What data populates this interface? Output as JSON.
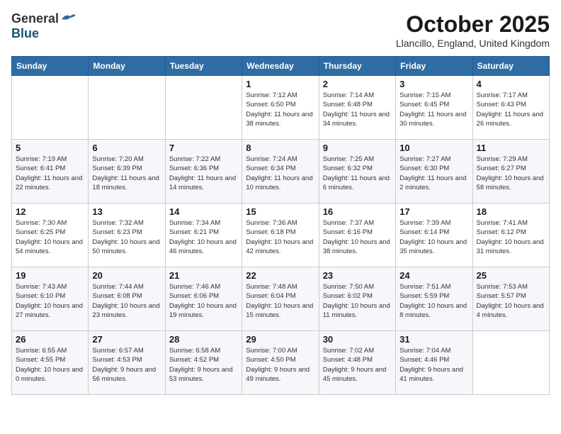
{
  "logo": {
    "general": "General",
    "blue": "Blue"
  },
  "title": "October 2025",
  "location": "Llancillo, England, United Kingdom",
  "days_of_week": [
    "Sunday",
    "Monday",
    "Tuesday",
    "Wednesday",
    "Thursday",
    "Friday",
    "Saturday"
  ],
  "weeks": [
    [
      {
        "day": "",
        "sunrise": "",
        "sunset": "",
        "daylight": ""
      },
      {
        "day": "",
        "sunrise": "",
        "sunset": "",
        "daylight": ""
      },
      {
        "day": "",
        "sunrise": "",
        "sunset": "",
        "daylight": ""
      },
      {
        "day": "1",
        "sunrise": "Sunrise: 7:12 AM",
        "sunset": "Sunset: 6:50 PM",
        "daylight": "Daylight: 11 hours and 38 minutes."
      },
      {
        "day": "2",
        "sunrise": "Sunrise: 7:14 AM",
        "sunset": "Sunset: 6:48 PM",
        "daylight": "Daylight: 11 hours and 34 minutes."
      },
      {
        "day": "3",
        "sunrise": "Sunrise: 7:15 AM",
        "sunset": "Sunset: 6:45 PM",
        "daylight": "Daylight: 11 hours and 30 minutes."
      },
      {
        "day": "4",
        "sunrise": "Sunrise: 7:17 AM",
        "sunset": "Sunset: 6:43 PM",
        "daylight": "Daylight: 11 hours and 26 minutes."
      }
    ],
    [
      {
        "day": "5",
        "sunrise": "Sunrise: 7:19 AM",
        "sunset": "Sunset: 6:41 PM",
        "daylight": "Daylight: 11 hours and 22 minutes."
      },
      {
        "day": "6",
        "sunrise": "Sunrise: 7:20 AM",
        "sunset": "Sunset: 6:39 PM",
        "daylight": "Daylight: 11 hours and 18 minutes."
      },
      {
        "day": "7",
        "sunrise": "Sunrise: 7:22 AM",
        "sunset": "Sunset: 6:36 PM",
        "daylight": "Daylight: 11 hours and 14 minutes."
      },
      {
        "day": "8",
        "sunrise": "Sunrise: 7:24 AM",
        "sunset": "Sunset: 6:34 PM",
        "daylight": "Daylight: 11 hours and 10 minutes."
      },
      {
        "day": "9",
        "sunrise": "Sunrise: 7:25 AM",
        "sunset": "Sunset: 6:32 PM",
        "daylight": "Daylight: 11 hours and 6 minutes."
      },
      {
        "day": "10",
        "sunrise": "Sunrise: 7:27 AM",
        "sunset": "Sunset: 6:30 PM",
        "daylight": "Daylight: 11 hours and 2 minutes."
      },
      {
        "day": "11",
        "sunrise": "Sunrise: 7:29 AM",
        "sunset": "Sunset: 6:27 PM",
        "daylight": "Daylight: 10 hours and 58 minutes."
      }
    ],
    [
      {
        "day": "12",
        "sunrise": "Sunrise: 7:30 AM",
        "sunset": "Sunset: 6:25 PM",
        "daylight": "Daylight: 10 hours and 54 minutes."
      },
      {
        "day": "13",
        "sunrise": "Sunrise: 7:32 AM",
        "sunset": "Sunset: 6:23 PM",
        "daylight": "Daylight: 10 hours and 50 minutes."
      },
      {
        "day": "14",
        "sunrise": "Sunrise: 7:34 AM",
        "sunset": "Sunset: 6:21 PM",
        "daylight": "Daylight: 10 hours and 46 minutes."
      },
      {
        "day": "15",
        "sunrise": "Sunrise: 7:36 AM",
        "sunset": "Sunset: 6:18 PM",
        "daylight": "Daylight: 10 hours and 42 minutes."
      },
      {
        "day": "16",
        "sunrise": "Sunrise: 7:37 AM",
        "sunset": "Sunset: 6:16 PM",
        "daylight": "Daylight: 10 hours and 38 minutes."
      },
      {
        "day": "17",
        "sunrise": "Sunrise: 7:39 AM",
        "sunset": "Sunset: 6:14 PM",
        "daylight": "Daylight: 10 hours and 35 minutes."
      },
      {
        "day": "18",
        "sunrise": "Sunrise: 7:41 AM",
        "sunset": "Sunset: 6:12 PM",
        "daylight": "Daylight: 10 hours and 31 minutes."
      }
    ],
    [
      {
        "day": "19",
        "sunrise": "Sunrise: 7:43 AM",
        "sunset": "Sunset: 6:10 PM",
        "daylight": "Daylight: 10 hours and 27 minutes."
      },
      {
        "day": "20",
        "sunrise": "Sunrise: 7:44 AM",
        "sunset": "Sunset: 6:08 PM",
        "daylight": "Daylight: 10 hours and 23 minutes."
      },
      {
        "day": "21",
        "sunrise": "Sunrise: 7:46 AM",
        "sunset": "Sunset: 6:06 PM",
        "daylight": "Daylight: 10 hours and 19 minutes."
      },
      {
        "day": "22",
        "sunrise": "Sunrise: 7:48 AM",
        "sunset": "Sunset: 6:04 PM",
        "daylight": "Daylight: 10 hours and 15 minutes."
      },
      {
        "day": "23",
        "sunrise": "Sunrise: 7:50 AM",
        "sunset": "Sunset: 6:02 PM",
        "daylight": "Daylight: 10 hours and 11 minutes."
      },
      {
        "day": "24",
        "sunrise": "Sunrise: 7:51 AM",
        "sunset": "Sunset: 5:59 PM",
        "daylight": "Daylight: 10 hours and 8 minutes."
      },
      {
        "day": "25",
        "sunrise": "Sunrise: 7:53 AM",
        "sunset": "Sunset: 5:57 PM",
        "daylight": "Daylight: 10 hours and 4 minutes."
      }
    ],
    [
      {
        "day": "26",
        "sunrise": "Sunrise: 6:55 AM",
        "sunset": "Sunset: 4:55 PM",
        "daylight": "Daylight: 10 hours and 0 minutes."
      },
      {
        "day": "27",
        "sunrise": "Sunrise: 6:57 AM",
        "sunset": "Sunset: 4:53 PM",
        "daylight": "Daylight: 9 hours and 56 minutes."
      },
      {
        "day": "28",
        "sunrise": "Sunrise: 6:58 AM",
        "sunset": "Sunset: 4:52 PM",
        "daylight": "Daylight: 9 hours and 53 minutes."
      },
      {
        "day": "29",
        "sunrise": "Sunrise: 7:00 AM",
        "sunset": "Sunset: 4:50 PM",
        "daylight": "Daylight: 9 hours and 49 minutes."
      },
      {
        "day": "30",
        "sunrise": "Sunrise: 7:02 AM",
        "sunset": "Sunset: 4:48 PM",
        "daylight": "Daylight: 9 hours and 45 minutes."
      },
      {
        "day": "31",
        "sunrise": "Sunrise: 7:04 AM",
        "sunset": "Sunset: 4:46 PM",
        "daylight": "Daylight: 9 hours and 41 minutes."
      },
      {
        "day": "",
        "sunrise": "",
        "sunset": "",
        "daylight": ""
      }
    ]
  ]
}
